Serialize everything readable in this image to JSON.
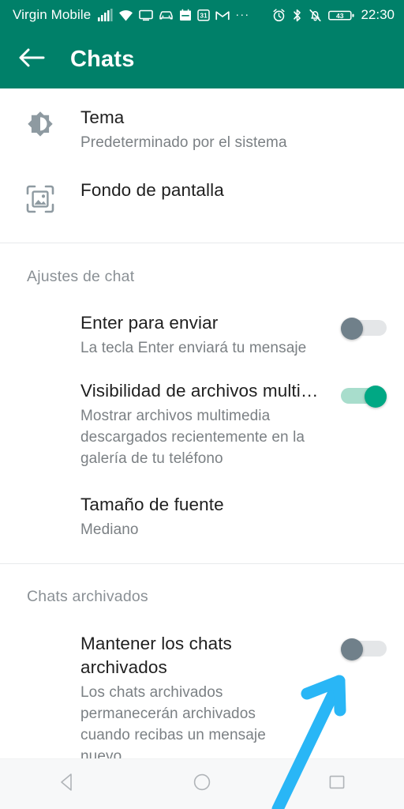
{
  "status_bar": {
    "carrier": "Virgin Mobile",
    "time": "22:30",
    "battery_level": "43",
    "left_icons": [
      "signal-bars-icon",
      "wifi-icon",
      "monitor-icon",
      "car-icon",
      "calendar-icon",
      "calendar-31-icon",
      "gmail-icon",
      "overflow-dots-icon"
    ],
    "right_icons": [
      "alarm-icon",
      "bluetooth-icon",
      "notifications-muted-icon",
      "battery-icon"
    ]
  },
  "app_bar": {
    "back_icon": "back-arrow-icon",
    "title": "Chats"
  },
  "settings": {
    "display_group": [
      {
        "icon": "theme-brightness-icon",
        "title": "Tema",
        "subtitle": "Predeterminado por el sistema"
      },
      {
        "icon": "wallpaper-image-icon",
        "title": "Fondo de pantalla",
        "subtitle": ""
      }
    ],
    "chat_settings": {
      "header": "Ajustes de chat",
      "items": [
        {
          "title": "Enter para enviar",
          "subtitle": "La tecla Enter enviará tu mensaje",
          "toggle": "off"
        },
        {
          "title": "Visibilidad de archivos multim…",
          "subtitle": "Mostrar archivos multimedia descargados recientemente en la galería de tu teléfono",
          "toggle": "on"
        },
        {
          "title": "Tamaño de fuente",
          "subtitle": "Mediano",
          "toggle": "none"
        }
      ]
    },
    "archived_chats": {
      "header": "Chats archivados",
      "items": [
        {
          "title": "Mantener los chats archivados",
          "subtitle": "Los chats archivados permanecerán archivados cuando recibas un mensaje nuevo",
          "toggle": "off"
        }
      ]
    }
  },
  "annotation": {
    "type": "arrow",
    "color": "#29b6f6",
    "points_to": "keep-chats-archived-toggle"
  },
  "nav_bar": {
    "buttons": [
      "nav-back-icon",
      "nav-home-icon",
      "nav-recents-icon"
    ]
  },
  "colors": {
    "header_green": "#008069",
    "toggle_on": "#00a884",
    "toggle_off_knob": "#70808a",
    "arrow_blue": "#29b6f6"
  }
}
